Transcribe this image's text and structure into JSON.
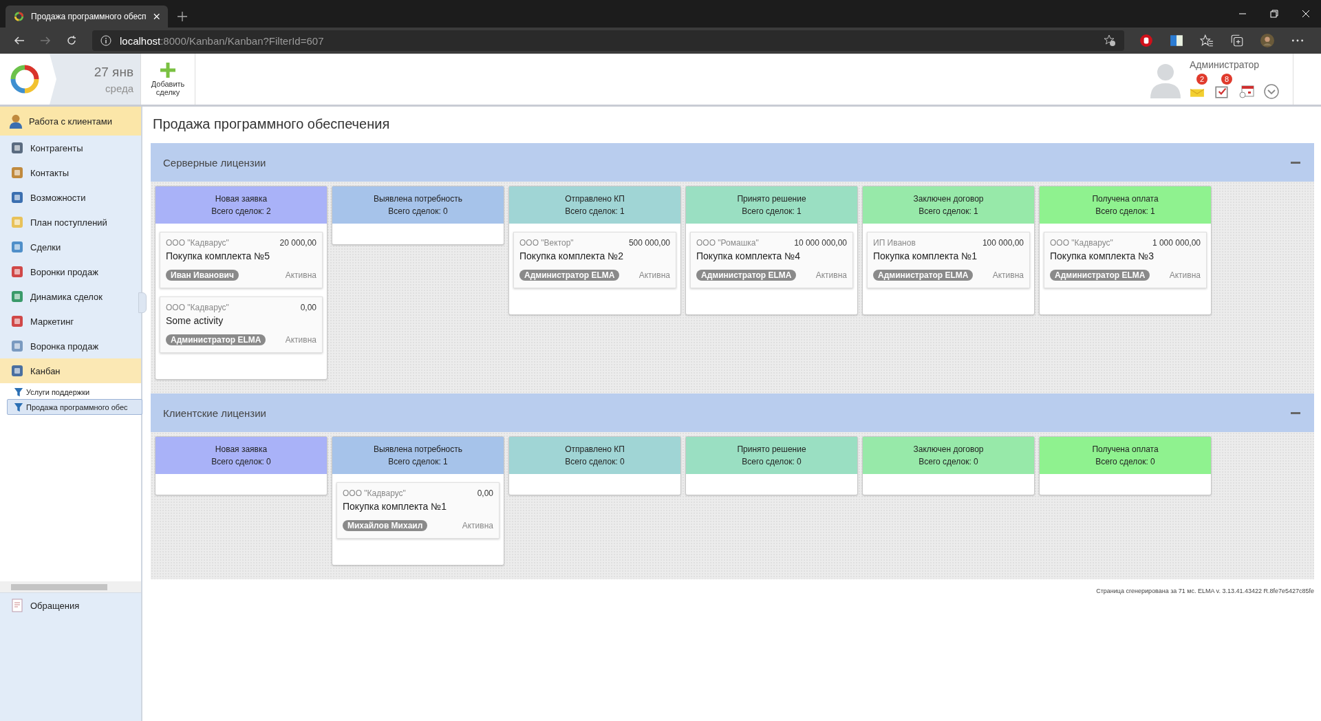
{
  "browser": {
    "tab_title": "Продажа программного обесп",
    "url_host": "localhost",
    "url_path": ":8000/Kanban/Kanban?FilterId=607"
  },
  "header": {
    "date": "27 янв",
    "weekday": "среда",
    "add_button": "Добавить сделку",
    "user": "Администратор",
    "badges": [
      {
        "count": "2"
      },
      {
        "count": "8"
      }
    ]
  },
  "sidebar": {
    "group": "Работа с клиентами",
    "items": [
      {
        "label": "Контрагенты",
        "selected": false
      },
      {
        "label": "Контакты",
        "selected": false
      },
      {
        "label": "Возможности",
        "selected": false
      },
      {
        "label": "План поступлений",
        "selected": false
      },
      {
        "label": "Сделки",
        "selected": false
      },
      {
        "label": "Воронки продаж",
        "selected": false
      },
      {
        "label": "Динамика сделок",
        "selected": false
      },
      {
        "label": "Маркетинг",
        "selected": false
      },
      {
        "label": "Воронка продаж",
        "selected": false
      },
      {
        "label": "Канбан",
        "selected": true,
        "children": [
          {
            "label": "Услуги поддержки",
            "selected": false
          },
          {
            "label": "Продажа программного обес",
            "selected": true
          }
        ]
      }
    ],
    "footer_item": "Обращения"
  },
  "page_title": "Продажа программного обеспечения",
  "sections": [
    {
      "title": "Серверные лицензии",
      "expanded": true,
      "columns": [
        {
          "title": "Новая заявка",
          "count": "Всего сделок: 2",
          "color": "#a9b2f8",
          "cards": [
            {
              "company": "ООО \"Кадварус\"",
              "amount": "20 000,00",
              "title": "Покупка комплекта №5",
              "owner": "Иван Иванович",
              "status": "Активна"
            },
            {
              "company": "ООО \"Кадварус\"",
              "amount": "0,00",
              "title": "Some activity",
              "owner": "Администратор ELMA",
              "status": "Активна"
            }
          ]
        },
        {
          "title": "Выявлена потребность",
          "count": "Всего сделок: 0",
          "color": "#a6c3ea"
        },
        {
          "title": "Отправлено КП",
          "count": "Всего сделок: 1",
          "color": "#a0d5d5",
          "cards": [
            {
              "company": "ООО \"Вектор\"",
              "amount": "500 000,00",
              "title": "Покупка комплекта №2",
              "owner": "Администратор ELMA",
              "status": "Активна"
            }
          ]
        },
        {
          "title": "Принято решение",
          "count": "Всего сделок: 1",
          "color": "#9adfc2",
          "cards": [
            {
              "company": "ООО \"Ромашка\"",
              "amount": "10 000 000,00",
              "title": "Покупка комплекта №4",
              "owner": "Администратор ELMA",
              "status": "Активна"
            }
          ]
        },
        {
          "title": "Заключен договор",
          "count": "Всего сделок: 1",
          "color": "#97e9a9",
          "cards": [
            {
              "company": "ИП Иванов",
              "amount": "100 000,00",
              "title": "Покупка комплекта №1",
              "owner": "Администратор ELMA",
              "status": "Активна"
            }
          ]
        },
        {
          "title": "Получена оплата",
          "count": "Всего сделок: 1",
          "color": "#8ff28f",
          "cards": [
            {
              "company": "ООО \"Кадварус\"",
              "amount": "1 000 000,00",
              "title": "Покупка комплекта №3",
              "owner": "Администратор ELMA",
              "status": "Активна"
            }
          ]
        }
      ]
    },
    {
      "title": "Клиентские лицензии",
      "expanded": true,
      "columns": [
        {
          "title": "Новая заявка",
          "count": "Всего сделок: 0",
          "color": "#a9b2f8"
        },
        {
          "title": "Выявлена потребность",
          "count": "Всего сделок: 1",
          "color": "#a6c3ea",
          "cards": [
            {
              "company": "ООО \"Кадварус\"",
              "amount": "0,00",
              "title": "Покупка комплекта №1",
              "owner": "Михайлов Михаил",
              "status": "Активна"
            }
          ]
        },
        {
          "title": "Отправлено КП",
          "count": "Всего сделок: 0",
          "color": "#a0d5d5"
        },
        {
          "title": "Принято решение",
          "count": "Всего сделок: 0",
          "color": "#9adfc2"
        },
        {
          "title": "Заключен договор",
          "count": "Всего сделок: 0",
          "color": "#97e9a9"
        },
        {
          "title": "Получена оплата",
          "count": "Всего сделок: 0",
          "color": "#8ff28f"
        }
      ]
    }
  ],
  "footer": "Страница сгенерирована за 71 мс. ELMA v. 3.13.41.43422 R.8fe7e5427c85fe"
}
